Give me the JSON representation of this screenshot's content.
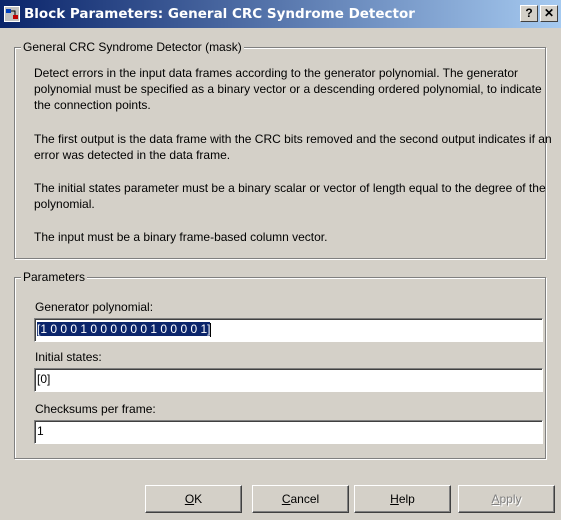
{
  "window": {
    "title": "Block Parameters: General CRC Syndrome Detector",
    "help_glyph": "?",
    "close_glyph": "✕"
  },
  "mask_group": {
    "legend": "General CRC Syndrome Detector (mask)",
    "paragraphs": [
      "Detect errors in the input data frames according to the generator polynomial. The generator polynomial must be specified as a binary vector or a descending ordered polynomial, to indicate the connection points.",
      "The first output is the data frame with the CRC bits removed and the second output indicates if an error was detected in the data frame.",
      "The initial states parameter must be a binary scalar or vector of length equal to the degree of the polynomial.",
      "The input must be a binary frame-based column vector."
    ]
  },
  "params_group": {
    "legend": "Parameters",
    "generator_label": "Generator polynomial:",
    "generator_value": "[1 0 0 0 1 0 0 0 0 0 0 1 0 0 0 0 1]",
    "initial_label": "Initial states:",
    "initial_value": "[0]",
    "checksums_label": "Checksums per frame:",
    "checksums_value": "1"
  },
  "buttons": {
    "ok_mnemonic": "O",
    "ok_rest": "K",
    "cancel_mnemonic": "C",
    "cancel_rest": "ancel",
    "help_mnemonic": "H",
    "help_rest": "elp",
    "apply_mnemonic": "A",
    "apply_rest": "pply"
  },
  "icons": {
    "app": "simulink-block-icon",
    "help": "question-mark-icon",
    "close": "close-icon"
  }
}
